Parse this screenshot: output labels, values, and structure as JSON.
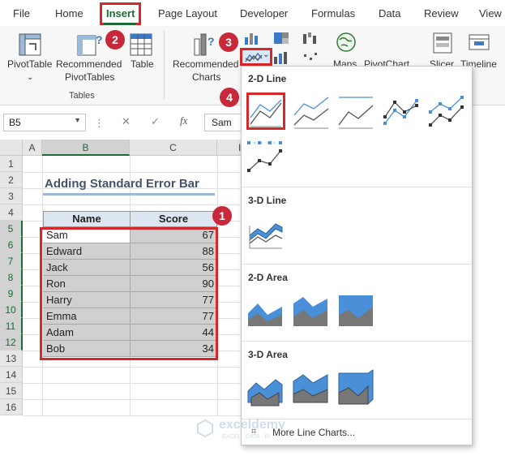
{
  "menu": {
    "tabs": [
      {
        "label": "File"
      },
      {
        "label": "Home"
      },
      {
        "label": "Insert",
        "active": true
      },
      {
        "label": "Page Layout"
      },
      {
        "label": "Developer"
      },
      {
        "label": "Formulas"
      },
      {
        "label": "Data"
      },
      {
        "label": "Review"
      },
      {
        "label": "View"
      }
    ]
  },
  "ribbon": {
    "pivot_table": "PivotTable",
    "recommended_pivot_1": "Recommended",
    "recommended_pivot_2": "PivotTables",
    "table": "Table",
    "tables_group": "Tables",
    "recommended_charts_1": "Recommended",
    "recommended_charts_2": "Charts",
    "maps": "Maps",
    "pivot_chart": "PivotChart",
    "slicer": "Slicer",
    "timeline": "Timeline",
    "dropdown_arrow": "⌄"
  },
  "formula_bar": {
    "name_box": "B5",
    "formula_value": "Sam",
    "fx": "fx"
  },
  "grid": {
    "columns": [
      "A",
      "B",
      "C"
    ],
    "col_d_partial": "I",
    "rows": [
      "1",
      "2",
      "3",
      "4",
      "5",
      "6",
      "7",
      "8",
      "9",
      "10",
      "11",
      "12",
      "13",
      "14",
      "15",
      "16"
    ],
    "title": "Adding Standard Error Bar",
    "headers": {
      "name": "Name",
      "score": "Score"
    },
    "data": [
      {
        "name": "Sam",
        "score": "67"
      },
      {
        "name": "Edward",
        "score": "88"
      },
      {
        "name": "Jack",
        "score": "56"
      },
      {
        "name": "Ron",
        "score": "90"
      },
      {
        "name": "Harry",
        "score": "77"
      },
      {
        "name": "Emma",
        "score": "77"
      },
      {
        "name": "Adam",
        "score": "44"
      },
      {
        "name": "Bob",
        "score": "34"
      }
    ]
  },
  "dropdown": {
    "section_2d_line": "2-D Line",
    "section_3d_line": "3-D Line",
    "section_2d_area": "2-D Area",
    "section_3d_area": "3-D Area",
    "more_link": "More Line Charts..."
  },
  "badges": {
    "b1": "1",
    "b2": "2",
    "b3": "3",
    "b4": "4"
  },
  "watermark": {
    "name": "exceldemy",
    "tagline": "EXCEL · DATA · BI"
  },
  "colors": {
    "accent": "#1a6b36",
    "highlight": "#d62828",
    "badge": "#c7293a",
    "chart_blue": "#4a90d9"
  }
}
